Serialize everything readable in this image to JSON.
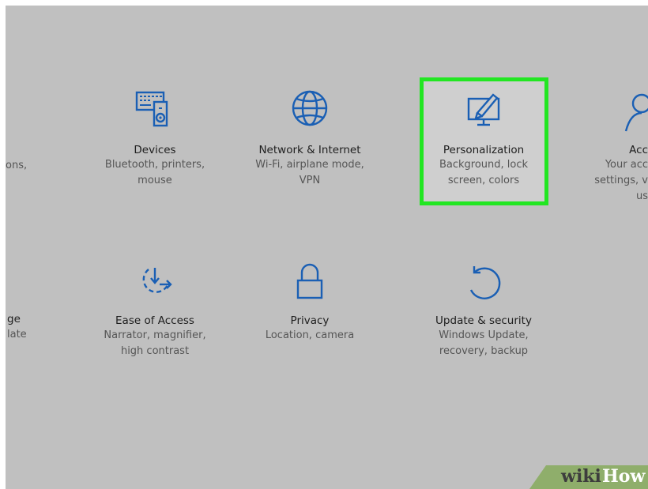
{
  "settings": {
    "row1": {
      "partial_left": {
        "desc": "ons,"
      },
      "devices": {
        "title": "Devices",
        "desc": "Bluetooth, printers, mouse",
        "icon": "devices-icon"
      },
      "network": {
        "title": "Network & Internet",
        "desc": "Wi-Fi, airplane mode, VPN",
        "icon": "globe-icon"
      },
      "personalization": {
        "title": "Personalization",
        "desc": "Background, lock screen, colors",
        "icon": "personalization-icon",
        "selected": true
      },
      "accounts_partial": {
        "title": "Acc",
        "desc_line1": "Your acc",
        "desc_line2": "settings, v",
        "desc_line3": "us",
        "icon": "person-icon"
      }
    },
    "row2": {
      "partial_left": {
        "title": "ge",
        "desc": "late"
      },
      "ease_of_access": {
        "title": "Ease of Access",
        "desc": "Narrator, magnifier, high contrast",
        "icon": "ease-of-access-icon"
      },
      "privacy": {
        "title": "Privacy",
        "desc": "Location, camera",
        "icon": "lock-icon"
      },
      "update_security": {
        "title": "Update & security",
        "desc": "Windows Update, recovery, backup",
        "icon": "update-icon"
      }
    }
  },
  "colors": {
    "background": "#c0c0c0",
    "icon_blue": "#1a5fb4",
    "highlight_green": "#22e622"
  },
  "watermark": {
    "wiki": "wiki",
    "how": "How"
  }
}
